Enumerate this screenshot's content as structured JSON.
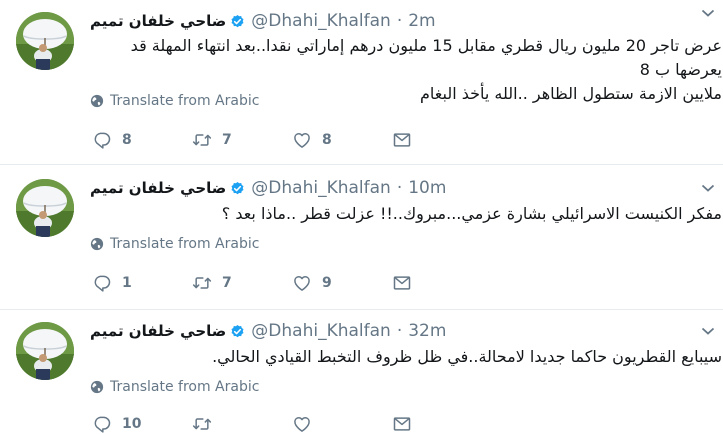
{
  "tweets": [
    {
      "name": "ضاحي خلفان تميم",
      "handle": "@Dhahi_Khalfan",
      "separator": "·",
      "time": "2m",
      "text_line1": "عرض تاجر 20 مليون ريال قطري مقابل 15 مليون درهم إماراتي نقدا..بعد انتهاء المهلة قد يعرضها ب 8",
      "text_line2": "ملايين الازمة ستطول الظاهر ..الله يأخذ البغام",
      "translate": "Translate from Arabic",
      "replies": "8",
      "retweets": "7",
      "likes": "8"
    },
    {
      "name": "ضاحي خلفان تميم",
      "handle": "@Dhahi_Khalfan",
      "separator": "·",
      "time": "10m",
      "text_line1": "مفكر الكنيست الاسرائيلي بشارة عزمي...مبروك..!! عزلت قطر ..ماذا بعد ؟",
      "translate": "Translate from Arabic",
      "replies": "1",
      "retweets": "7",
      "likes": "9"
    },
    {
      "name": "ضاحي خلفان تميم",
      "handle": "@Dhahi_Khalfan",
      "separator": "·",
      "time": "32m",
      "text_line1": "سيبايع القطريون حاكما جديدا لامحالة..في ظل ظروف التخبط القيادي الحالي.",
      "translate": "Translate from Arabic",
      "replies": "10",
      "retweets": "",
      "likes": ""
    }
  ],
  "icons": {
    "verified": "verified-badge-icon",
    "caret": "chevron-down-icon",
    "globe": "globe-icon",
    "reply": "reply-icon",
    "retweet": "retweet-icon",
    "like": "heart-icon",
    "dm": "envelope-icon"
  },
  "colors": {
    "verified": "#1da1f2",
    "muted": "#657786",
    "text": "#14171a",
    "divider": "#e6ecf0"
  }
}
